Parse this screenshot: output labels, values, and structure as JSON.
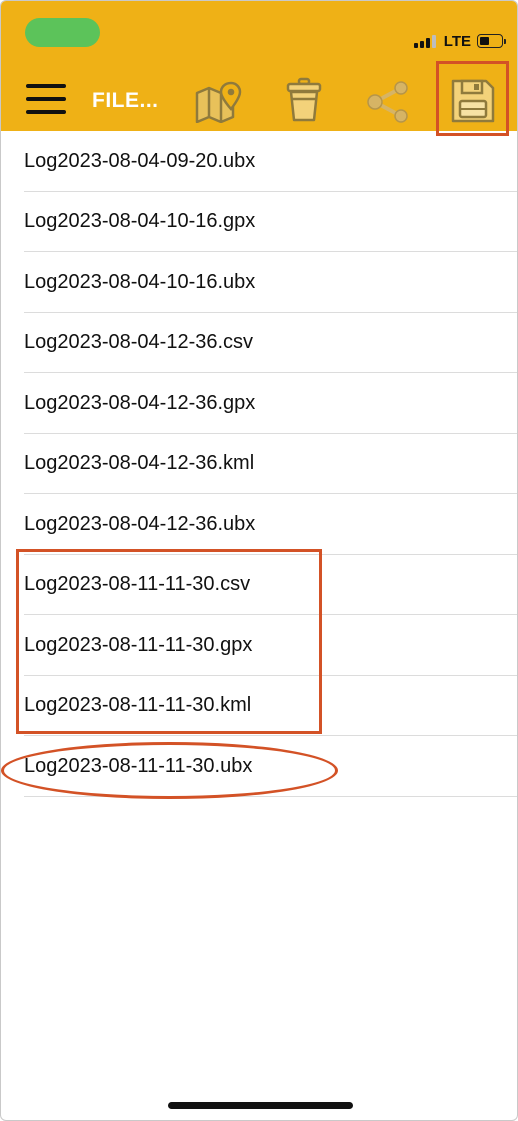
{
  "app": {
    "title": "FILE...",
    "header_color": "#efb116",
    "highlight_color": "#d35226"
  },
  "status_bar": {
    "network": "LTE",
    "icons": [
      "signal-icon",
      "battery-icon"
    ]
  },
  "toolbar": {
    "icons": [
      "menu-icon",
      "map-pin-icon",
      "trash-icon",
      "share-icon",
      "save-icon"
    ]
  },
  "files": [
    "Log2023-08-04-09-20.ubx",
    "Log2023-08-04-10-16.gpx",
    "Log2023-08-04-10-16.ubx",
    "Log2023-08-04-12-36.csv",
    "Log2023-08-04-12-36.gpx",
    "Log2023-08-04-12-36.kml",
    "Log2023-08-04-12-36.ubx",
    "Log2023-08-11-11-30.csv",
    "Log2023-08-11-11-30.gpx",
    "Log2023-08-11-11-30.kml",
    "Log2023-08-11-11-30.ubx"
  ]
}
